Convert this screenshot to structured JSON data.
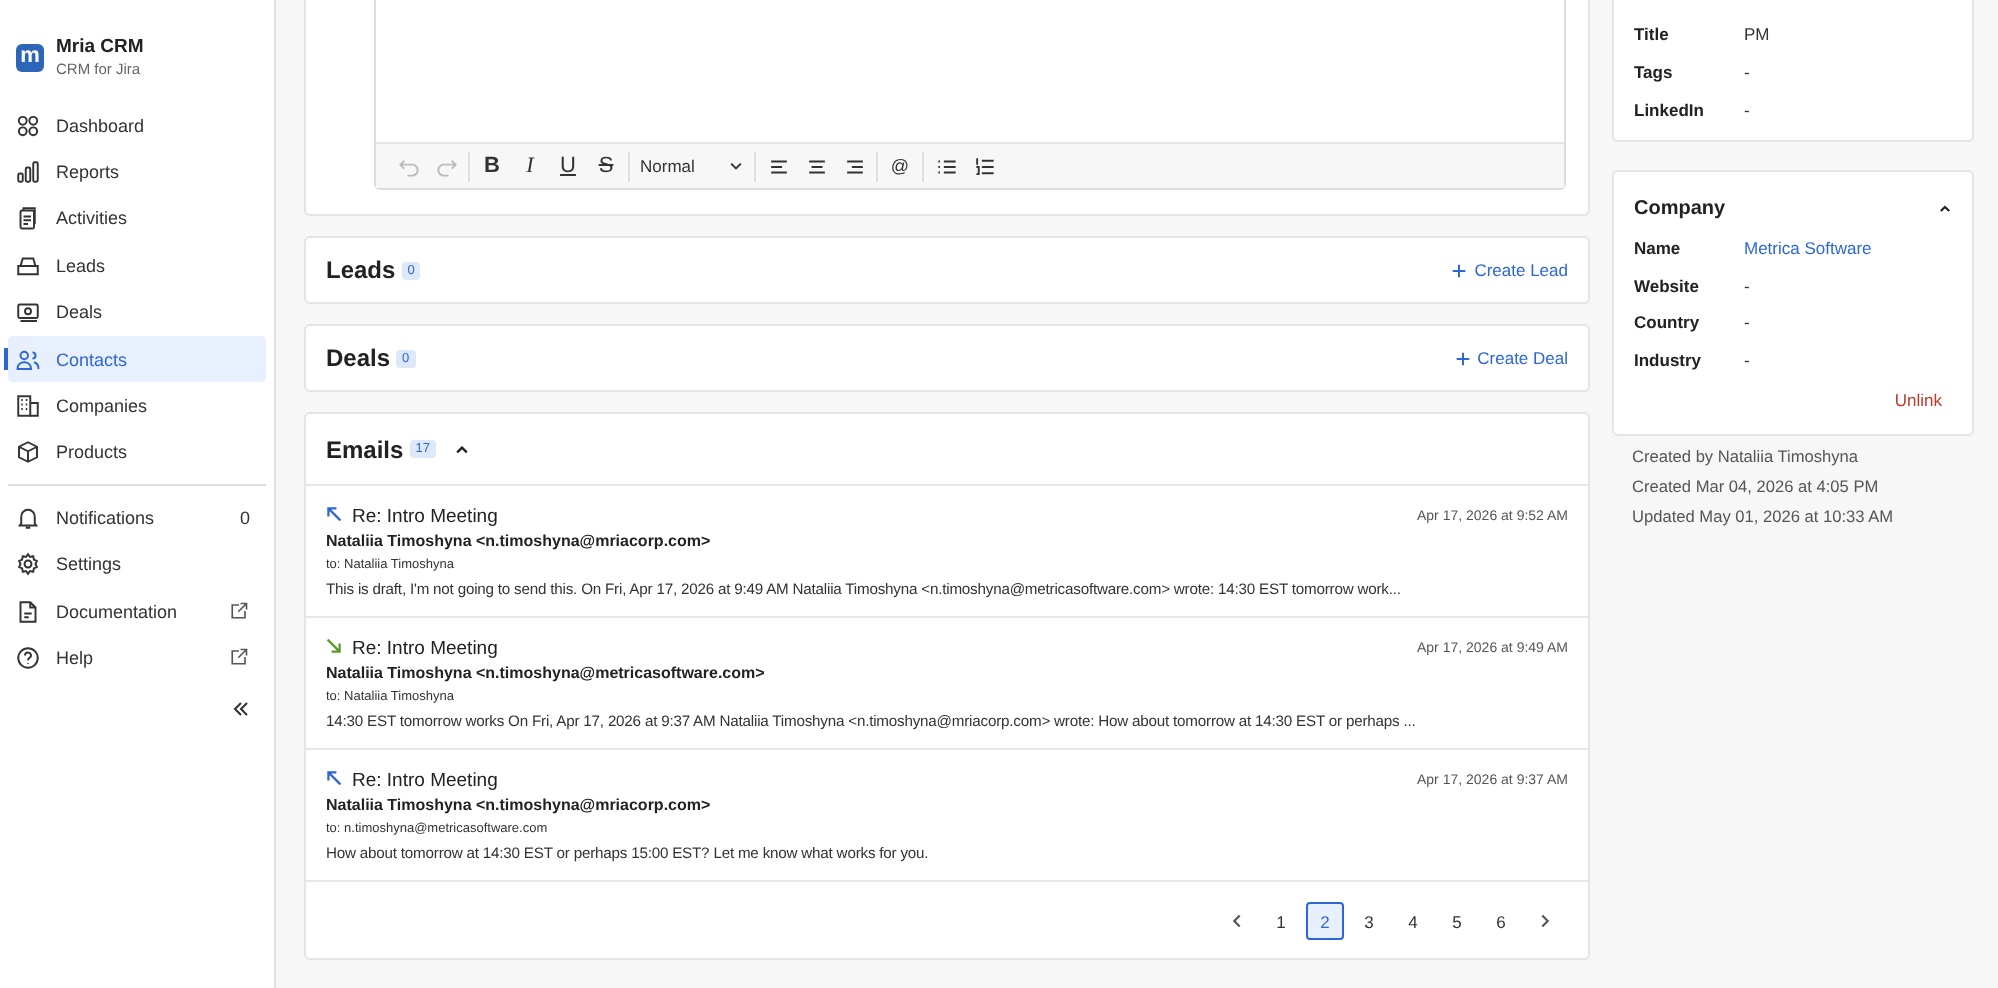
{
  "app": {
    "name": "Mria CRM",
    "subtitle": "CRM for Jira",
    "logo": "m"
  },
  "sidebar": {
    "items": [
      {
        "label": "Dashboard",
        "kind": "dashboard",
        "selected": false
      },
      {
        "label": "Reports",
        "kind": "reports",
        "selected": false
      },
      {
        "label": "Activities",
        "kind": "activities",
        "selected": false
      },
      {
        "label": "Leads",
        "kind": "leads",
        "selected": false
      },
      {
        "label": "Deals",
        "kind": "deals",
        "selected": false
      },
      {
        "label": "Contacts",
        "kind": "contacts",
        "selected": true
      },
      {
        "label": "Companies",
        "kind": "companies",
        "selected": false
      },
      {
        "label": "Products",
        "kind": "products",
        "selected": false
      }
    ],
    "bottom_items": [
      {
        "label": "Notifications",
        "kind": "bell",
        "count": "0"
      },
      {
        "label": "Settings",
        "kind": "gear"
      },
      {
        "label": "Documentation",
        "kind": "doc",
        "external": true
      },
      {
        "label": "Help",
        "kind": "help",
        "external": true
      }
    ]
  },
  "editor": {
    "toolbar_groups": [
      {
        "items": [
          {
            "kind": "undo",
            "disabled": true
          },
          {
            "kind": "redo",
            "disabled": true
          }
        ]
      },
      {
        "items": [
          {
            "kind": "bold",
            "label": "B"
          },
          {
            "kind": "italic",
            "label": "I"
          },
          {
            "kind": "underline",
            "label": "U"
          },
          {
            "kind": "strike",
            "label": "S"
          }
        ]
      },
      {
        "items": [
          {
            "kind": "select",
            "label": "Normal"
          }
        ]
      },
      {
        "items": [
          {
            "kind": "align-left"
          },
          {
            "kind": "align-center"
          },
          {
            "kind": "align-right"
          }
        ]
      },
      {
        "items": [
          {
            "kind": "mention",
            "label": "@"
          }
        ]
      },
      {
        "items": [
          {
            "kind": "bullet-list"
          },
          {
            "kind": "ordered-list"
          }
        ]
      }
    ]
  },
  "leads": {
    "title": "Leads",
    "count": "0",
    "action": "Create Lead"
  },
  "deals": {
    "title": "Deals",
    "count": "0",
    "action": "Create Deal"
  },
  "emails": {
    "title": "Emails",
    "count": "17",
    "expanded": true,
    "items": [
      {
        "kind": "sent",
        "subject": "Re: Intro Meeting",
        "date": "Apr 17, 2026 at 9:52 AM",
        "from": "Nataliia Timoshyna <n.timoshyna@mriacorp.com>",
        "to": "to: Nataliia Timoshyna",
        "preview": "This is draft, I'm not going to send this. On Fri, Apr 17, 2026 at 9:49 AM Nataliia Timoshyna <n.timoshyna@metricasoftware.com> wrote: 14:30 EST tomorrow work..."
      },
      {
        "kind": "received",
        "subject": "Re: Intro Meeting",
        "date": "Apr 17, 2026 at 9:49 AM",
        "from": "Nataliia Timoshyna <n.timoshyna@metricasoftware.com>",
        "to": "to: Nataliia Timoshyna",
        "preview": "14:30 EST tomorrow works On Fri, Apr 17, 2026 at 9:37 AM Nataliia Timoshyna <n.timoshyna@mriacorp.com> wrote: How about tomorrow at 14:30 EST or perhaps ..."
      },
      {
        "kind": "sent",
        "subject": "Re: Intro Meeting",
        "date": "Apr 17, 2026 at 9:37 AM",
        "from": "Nataliia Timoshyna <n.timoshyna@mriacorp.com>",
        "to": "to: n.timoshyna@metricasoftware.com",
        "preview": "How about tomorrow at 14:30 EST or perhaps 15:00 EST? Let me know what works for you."
      }
    ],
    "pages": [
      {
        "label": "1",
        "selected": false
      },
      {
        "label": "2",
        "selected": true
      },
      {
        "label": "3",
        "selected": false
      },
      {
        "label": "4",
        "selected": false
      },
      {
        "label": "5",
        "selected": false
      },
      {
        "label": "6",
        "selected": false
      }
    ]
  },
  "contact_fields": [
    {
      "label": "Title",
      "value": "PM"
    },
    {
      "label": "Tags",
      "value": "-"
    },
    {
      "label": "LinkedIn",
      "value": "-"
    }
  ],
  "company": {
    "title": "Company",
    "expanded": true,
    "fields": [
      {
        "label": "Name",
        "value": "Metrica Software",
        "link": true
      },
      {
        "label": "Website",
        "value": "-",
        "link": false
      },
      {
        "label": "Country",
        "value": "-",
        "link": false
      },
      {
        "label": "Industry",
        "value": "-",
        "link": false
      }
    ],
    "action": "Unlink"
  },
  "meta": [
    "Created by Nataliia Timoshyna",
    "Created Mar 04, 2026 at 4:05 PM",
    "Updated May 01, 2026 at 10:33 AM"
  ]
}
